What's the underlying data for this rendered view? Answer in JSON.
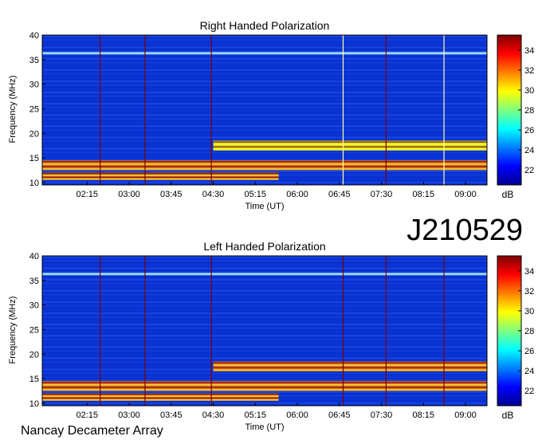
{
  "colors": {
    "colormap": [
      "#00008f",
      "#0000ff",
      "#007fff",
      "#00ffff",
      "#7fff7f",
      "#ffff00",
      "#ff7f00",
      "#ff0000",
      "#7f0000"
    ],
    "background": "#0a2fd0"
  },
  "footer": {
    "label": "Nancay Decameter Array"
  },
  "date_code": "J210529",
  "chart_data": [
    {
      "type": "heatmap",
      "title": "Right Handed Polarization",
      "xlabel": "Time (UT)",
      "ylabel": "Frequency (MHz)",
      "x_ticks": [
        "02:15",
        "03:00",
        "03:45",
        "04:30",
        "05:15",
        "06:00",
        "06:45",
        "07:30",
        "08:15",
        "09:00"
      ],
      "x_tick_minutes": [
        135,
        180,
        225,
        270,
        315,
        360,
        405,
        450,
        495,
        540
      ],
      "xlim_minutes": [
        87,
        563
      ],
      "y_ticks": [
        "40",
        "35",
        "30",
        "25",
        "20",
        "15",
        "10"
      ],
      "y_tick_values": [
        40,
        35,
        30,
        25,
        20,
        15,
        10
      ],
      "ylim": [
        9.5,
        40
      ],
      "colorbar": {
        "label": "dB",
        "ticks": [
          "34",
          "32",
          "30",
          "28",
          "26",
          "24",
          "22"
        ],
        "tick_values": [
          34,
          32,
          30,
          28,
          26,
          24,
          22
        ],
        "range": [
          20.5,
          35.5
        ]
      },
      "emission_bands": [
        {
          "f_low": 16.5,
          "f_high": 18.5,
          "t_start": 270,
          "t_end": 563,
          "level_db": 30
        },
        {
          "f_low": 12.5,
          "f_high": 14.5,
          "t_start": 87,
          "t_end": 563,
          "level_db": 32
        },
        {
          "f_low": 10.5,
          "f_high": 12.0,
          "t_start": 87,
          "t_end": 340,
          "level_db": 31
        }
      ],
      "vertical_lines_minutes": [
        149,
        197,
        268,
        409,
        455,
        517
      ]
    },
    {
      "type": "heatmap",
      "title": "Left Handed Polarization",
      "xlabel": "Time (UT)",
      "ylabel": "Frequency (MHz)",
      "x_ticks": [
        "02:15",
        "03:00",
        "03:45",
        "04:30",
        "05:15",
        "06:00",
        "06:45",
        "07:30",
        "08:15",
        "09:00"
      ],
      "x_tick_minutes": [
        135,
        180,
        225,
        270,
        315,
        360,
        405,
        450,
        495,
        540
      ],
      "xlim_minutes": [
        87,
        563
      ],
      "y_ticks": [
        "40",
        "35",
        "30",
        "25",
        "20",
        "15",
        "10"
      ],
      "y_tick_values": [
        40,
        35,
        30,
        25,
        20,
        15,
        10
      ],
      "ylim": [
        9.5,
        40
      ],
      "colorbar": {
        "label": "dB",
        "ticks": [
          "34",
          "32",
          "30",
          "28",
          "26",
          "24",
          "22"
        ],
        "tick_values": [
          34,
          32,
          30,
          28,
          26,
          24,
          22
        ],
        "range": [
          20.5,
          35.5
        ]
      },
      "emission_bands": [
        {
          "f_low": 16.5,
          "f_high": 18.5,
          "t_start": 270,
          "t_end": 563,
          "level_db": 31
        },
        {
          "f_low": 12.5,
          "f_high": 14.5,
          "t_start": 87,
          "t_end": 563,
          "level_db": 32
        },
        {
          "f_low": 10.5,
          "f_high": 12.0,
          "t_start": 87,
          "t_end": 340,
          "level_db": 31
        }
      ],
      "vertical_lines_minutes": [
        149,
        197,
        268,
        409,
        455,
        517
      ]
    }
  ]
}
